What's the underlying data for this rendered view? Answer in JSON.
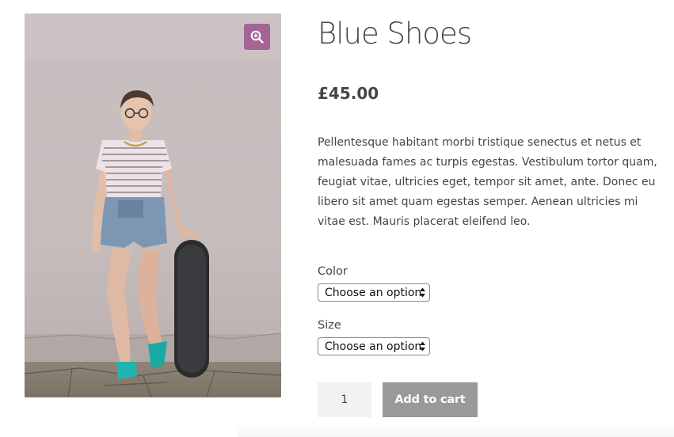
{
  "product": {
    "title": "Blue Shoes",
    "price": "£45.00",
    "description": "Pellentesque habitant morbi tristique senectus et netus et malesuada fames ac turpis egestas. Vestibulum tortor quam, feugiat vitae, ultricies eget, tempor sit amet, ante. Donec eu libero sit amet quam egestas semper. Aenean ultricies mi vitae est. Mauris placerat eleifend leo."
  },
  "gallery": {
    "zoom_icon": "zoom-in-icon",
    "accent_color": "#a46497"
  },
  "variations": {
    "color": {
      "label": "Color",
      "selected": "Choose an option"
    },
    "size": {
      "label": "Size",
      "selected": "Choose an option"
    }
  },
  "cart": {
    "quantity": "1",
    "button_label": "Add to cart",
    "button_color": "#999999"
  }
}
